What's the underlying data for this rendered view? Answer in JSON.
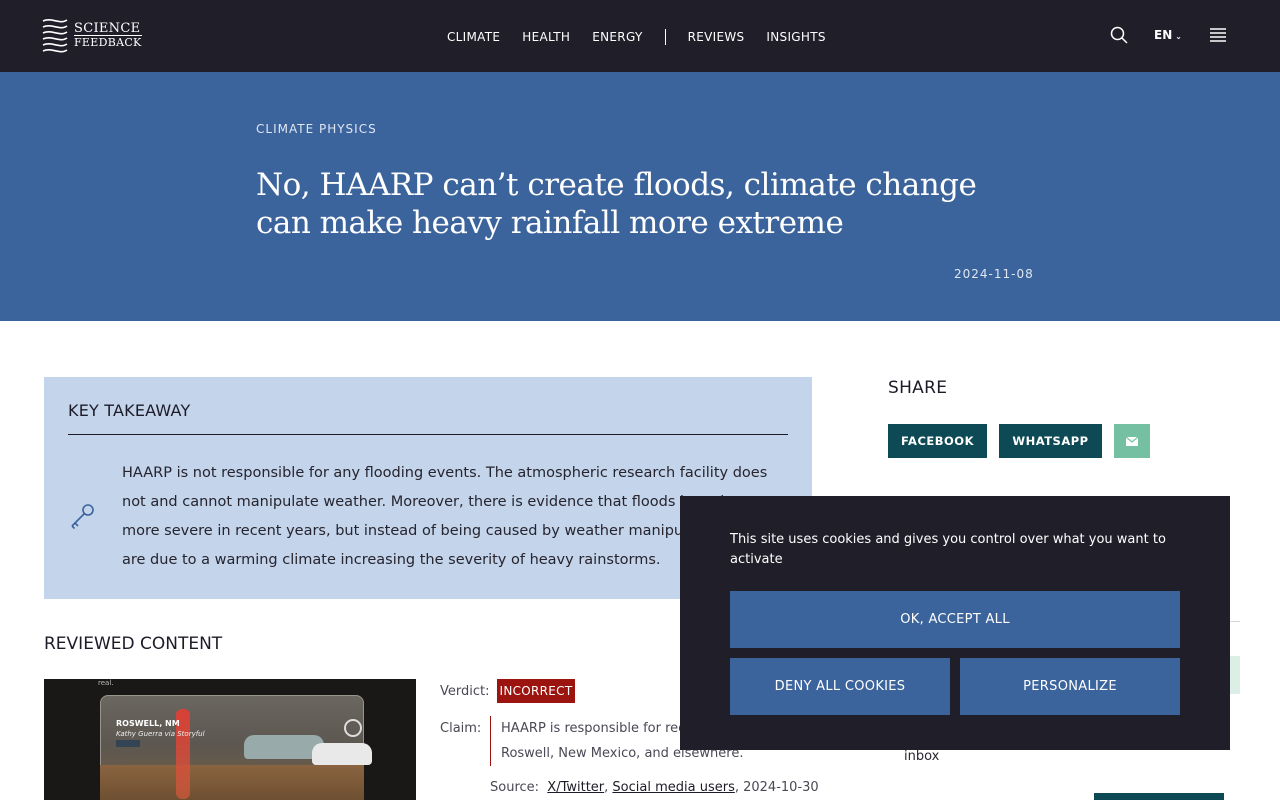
{
  "header": {
    "logo": {
      "line1": "SCIENCE",
      "line2": "FEEDBACK"
    },
    "nav": [
      "CLIMATE",
      "HEALTH",
      "ENERGY",
      "REVIEWS",
      "INSIGHTS"
    ],
    "language": "EN"
  },
  "article": {
    "category": "CLIMATE PHYSICS",
    "title": "No, HAARP can’t create floods, climate change can make heavy rainfall more extreme",
    "date": "2024-11-08"
  },
  "key_takeaway": {
    "heading": "KEY TAKEAWAY",
    "text": "HAARP is not responsible for any flooding events. The atmospheric research facility does not and cannot manipulate weather. Moreover, there is evidence that floods have become more severe in recent years, but instead of being caused by weather manipulation, they are due to a warming climate increasing the severity of heavy rainstorms."
  },
  "reviewed": {
    "heading": "REVIEWED CONTENT",
    "thumbnail": {
      "corner_text": "real.",
      "caption_location": "ROSWELL, NM",
      "caption_credit": "Kathy Guerra via Storyful"
    },
    "verdict_label": "Verdict:",
    "verdict": "INCORRECT",
    "claim_label": "Claim:",
    "claim": "HAARP is responsible for recent floods in Roswell, New Mexico, and elsewhere.",
    "source_label": "Source:",
    "source_link1": "X/Twitter",
    "source_link2": "Social media users",
    "source_date": ", 2024-10-30"
  },
  "share": {
    "heading": "SHARE",
    "facebook": "FACEBOOK",
    "whatsapp": "WHATSAPP"
  },
  "sidebar": {
    "inbox_text": "inbox"
  },
  "cookie": {
    "message": "This site uses cookies and gives you control over what you want to activate",
    "accept": "OK, ACCEPT ALL",
    "deny": "DENY ALL COOKIES",
    "personalize": "PERSONALIZE"
  },
  "colors": {
    "header_bg": "#201e29",
    "hero_bg": "#3b639c",
    "takeaway_bg": "#c3d4eb",
    "verdict_red": "#9c1410",
    "share_teal": "#0e4a55",
    "mail_green": "#75bfa2"
  },
  "icons": [
    "logo-wave-icon",
    "search-icon",
    "chevron-down-icon",
    "menu-icon",
    "key-icon",
    "mail-icon"
  ]
}
